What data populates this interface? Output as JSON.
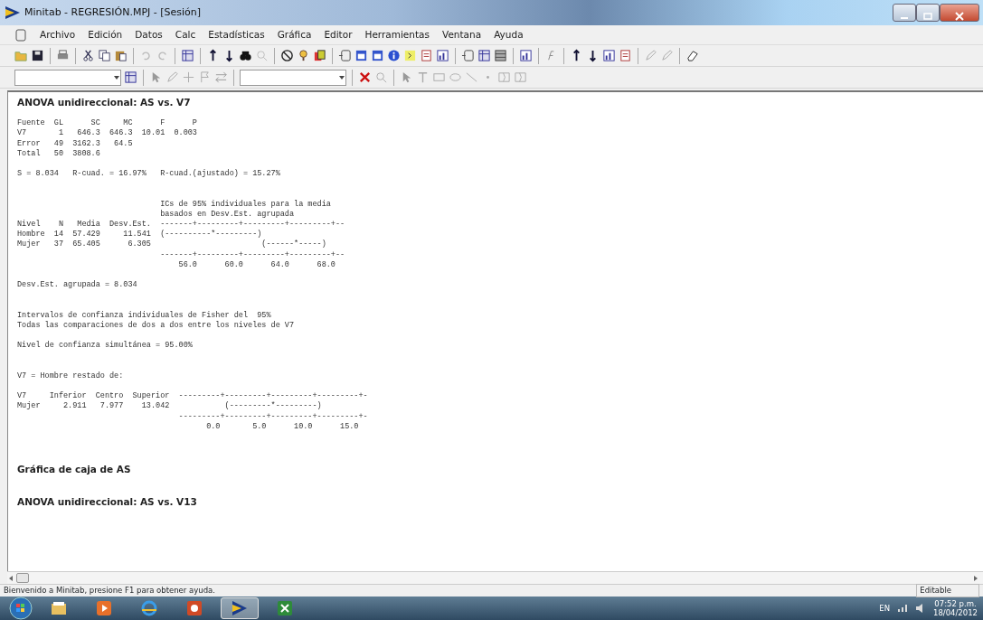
{
  "window": {
    "title": "Minitab - REGRESIÓN.MPJ - [Sesión]"
  },
  "menu": [
    "Archivo",
    "Edición",
    "Datos",
    "Calc",
    "Estadísticas",
    "Gráfica",
    "Editor",
    "Herramientas",
    "Ventana",
    "Ayuda"
  ],
  "session": [
    {
      "kind": "heading",
      "text": "ANOVA unidireccional: AS vs. V7"
    },
    {
      "kind": "blank"
    },
    {
      "kind": "line",
      "text": "Fuente  GL      SC     MC      F      P"
    },
    {
      "kind": "line",
      "text": "V7       1   646.3  646.3  10.01  0.003"
    },
    {
      "kind": "line",
      "text": "Error   49  3162.3   64.5"
    },
    {
      "kind": "line",
      "text": "Total   50  3808.6"
    },
    {
      "kind": "blank"
    },
    {
      "kind": "line",
      "text": "S = 8.034   R-cuad. = 16.97%   R-cuad.(ajustado) = 15.27%"
    },
    {
      "kind": "blank"
    },
    {
      "kind": "blank"
    },
    {
      "kind": "line",
      "text": "                               ICs de 95% individuales para la media"
    },
    {
      "kind": "line",
      "text": "                               basados en Desv.Est. agrupada"
    },
    {
      "kind": "line",
      "text": "Nivel    N   Media  Desv.Est.  -------+---------+---------+---------+--"
    },
    {
      "kind": "line",
      "text": "Hombre  14  57.429     11.541  (----------*---------)"
    },
    {
      "kind": "line",
      "text": "Mujer   37  65.405      6.305                        (------*-----)"
    },
    {
      "kind": "line",
      "text": "                               -------+---------+---------+---------+--"
    },
    {
      "kind": "line",
      "text": "                                   56.0      60.0      64.0      68.0"
    },
    {
      "kind": "blank"
    },
    {
      "kind": "line",
      "text": "Desv.Est. agrupada = 8.034"
    },
    {
      "kind": "blank"
    },
    {
      "kind": "blank"
    },
    {
      "kind": "line",
      "text": "Intervalos de confianza individuales de Fisher del  95%"
    },
    {
      "kind": "line",
      "text": "Todas las comparaciones de dos a dos entre los niveles de V7"
    },
    {
      "kind": "blank"
    },
    {
      "kind": "line",
      "text": "Nivel de confianza simultánea = 95.00%"
    },
    {
      "kind": "blank"
    },
    {
      "kind": "blank"
    },
    {
      "kind": "line",
      "text": "V7 = Hombre restado de:"
    },
    {
      "kind": "blank"
    },
    {
      "kind": "line",
      "text": "V7     Inferior  Centro  Superior  ---------+---------+---------+---------+-"
    },
    {
      "kind": "line",
      "text": "Mujer     2.911   7.977    13.042            (---------*---------)"
    },
    {
      "kind": "line",
      "text": "                                   ---------+---------+---------+---------+-"
    },
    {
      "kind": "line",
      "text": "                                         0.0       5.0      10.0      15.0"
    },
    {
      "kind": "blank"
    },
    {
      "kind": "blank"
    },
    {
      "kind": "blank"
    },
    {
      "kind": "heading",
      "text": "Gráfica de caja de AS"
    },
    {
      "kind": "blank"
    },
    {
      "kind": "blank"
    },
    {
      "kind": "heading",
      "text": "ANOVA unidireccional: AS vs. V13"
    }
  ],
  "status_bar": {
    "message": "Bienvenido a Minitab, presione F1 para obtener ayuda.",
    "mode": "Editable"
  },
  "taskbar": {
    "apps": [
      {
        "kind": "folder",
        "selected": false
      },
      {
        "kind": "media",
        "selected": false
      },
      {
        "kind": "browser",
        "selected": false
      },
      {
        "kind": "slides",
        "selected": false
      },
      {
        "kind": "minitab",
        "selected": true
      },
      {
        "kind": "sheet",
        "selected": false
      }
    ],
    "language": "EN",
    "time": "07:52 p.m.",
    "date": "18/04/2012"
  }
}
